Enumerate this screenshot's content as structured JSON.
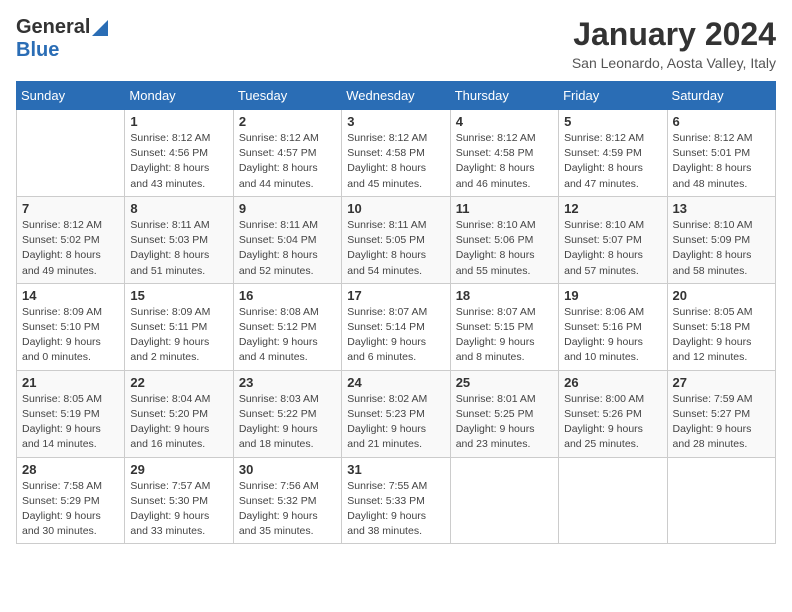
{
  "logo": {
    "general": "General",
    "blue": "Blue"
  },
  "title": "January 2024",
  "location": "San Leonardo, Aosta Valley, Italy",
  "weekdays": [
    "Sunday",
    "Monday",
    "Tuesday",
    "Wednesday",
    "Thursday",
    "Friday",
    "Saturday"
  ],
  "weeks": [
    [
      {
        "day": "",
        "sunrise": "",
        "sunset": "",
        "daylight": ""
      },
      {
        "day": "1",
        "sunrise": "Sunrise: 8:12 AM",
        "sunset": "Sunset: 4:56 PM",
        "daylight": "Daylight: 8 hours and 43 minutes."
      },
      {
        "day": "2",
        "sunrise": "Sunrise: 8:12 AM",
        "sunset": "Sunset: 4:57 PM",
        "daylight": "Daylight: 8 hours and 44 minutes."
      },
      {
        "day": "3",
        "sunrise": "Sunrise: 8:12 AM",
        "sunset": "Sunset: 4:58 PM",
        "daylight": "Daylight: 8 hours and 45 minutes."
      },
      {
        "day": "4",
        "sunrise": "Sunrise: 8:12 AM",
        "sunset": "Sunset: 4:58 PM",
        "daylight": "Daylight: 8 hours and 46 minutes."
      },
      {
        "day": "5",
        "sunrise": "Sunrise: 8:12 AM",
        "sunset": "Sunset: 4:59 PM",
        "daylight": "Daylight: 8 hours and 47 minutes."
      },
      {
        "day": "6",
        "sunrise": "Sunrise: 8:12 AM",
        "sunset": "Sunset: 5:01 PM",
        "daylight": "Daylight: 8 hours and 48 minutes."
      }
    ],
    [
      {
        "day": "7",
        "sunrise": "Sunrise: 8:12 AM",
        "sunset": "Sunset: 5:02 PM",
        "daylight": "Daylight: 8 hours and 49 minutes."
      },
      {
        "day": "8",
        "sunrise": "Sunrise: 8:11 AM",
        "sunset": "Sunset: 5:03 PM",
        "daylight": "Daylight: 8 hours and 51 minutes."
      },
      {
        "day": "9",
        "sunrise": "Sunrise: 8:11 AM",
        "sunset": "Sunset: 5:04 PM",
        "daylight": "Daylight: 8 hours and 52 minutes."
      },
      {
        "day": "10",
        "sunrise": "Sunrise: 8:11 AM",
        "sunset": "Sunset: 5:05 PM",
        "daylight": "Daylight: 8 hours and 54 minutes."
      },
      {
        "day": "11",
        "sunrise": "Sunrise: 8:10 AM",
        "sunset": "Sunset: 5:06 PM",
        "daylight": "Daylight: 8 hours and 55 minutes."
      },
      {
        "day": "12",
        "sunrise": "Sunrise: 8:10 AM",
        "sunset": "Sunset: 5:07 PM",
        "daylight": "Daylight: 8 hours and 57 minutes."
      },
      {
        "day": "13",
        "sunrise": "Sunrise: 8:10 AM",
        "sunset": "Sunset: 5:09 PM",
        "daylight": "Daylight: 8 hours and 58 minutes."
      }
    ],
    [
      {
        "day": "14",
        "sunrise": "Sunrise: 8:09 AM",
        "sunset": "Sunset: 5:10 PM",
        "daylight": "Daylight: 9 hours and 0 minutes."
      },
      {
        "day": "15",
        "sunrise": "Sunrise: 8:09 AM",
        "sunset": "Sunset: 5:11 PM",
        "daylight": "Daylight: 9 hours and 2 minutes."
      },
      {
        "day": "16",
        "sunrise": "Sunrise: 8:08 AM",
        "sunset": "Sunset: 5:12 PM",
        "daylight": "Daylight: 9 hours and 4 minutes."
      },
      {
        "day": "17",
        "sunrise": "Sunrise: 8:07 AM",
        "sunset": "Sunset: 5:14 PM",
        "daylight": "Daylight: 9 hours and 6 minutes."
      },
      {
        "day": "18",
        "sunrise": "Sunrise: 8:07 AM",
        "sunset": "Sunset: 5:15 PM",
        "daylight": "Daylight: 9 hours and 8 minutes."
      },
      {
        "day": "19",
        "sunrise": "Sunrise: 8:06 AM",
        "sunset": "Sunset: 5:16 PM",
        "daylight": "Daylight: 9 hours and 10 minutes."
      },
      {
        "day": "20",
        "sunrise": "Sunrise: 8:05 AM",
        "sunset": "Sunset: 5:18 PM",
        "daylight": "Daylight: 9 hours and 12 minutes."
      }
    ],
    [
      {
        "day": "21",
        "sunrise": "Sunrise: 8:05 AM",
        "sunset": "Sunset: 5:19 PM",
        "daylight": "Daylight: 9 hours and 14 minutes."
      },
      {
        "day": "22",
        "sunrise": "Sunrise: 8:04 AM",
        "sunset": "Sunset: 5:20 PM",
        "daylight": "Daylight: 9 hours and 16 minutes."
      },
      {
        "day": "23",
        "sunrise": "Sunrise: 8:03 AM",
        "sunset": "Sunset: 5:22 PM",
        "daylight": "Daylight: 9 hours and 18 minutes."
      },
      {
        "day": "24",
        "sunrise": "Sunrise: 8:02 AM",
        "sunset": "Sunset: 5:23 PM",
        "daylight": "Daylight: 9 hours and 21 minutes."
      },
      {
        "day": "25",
        "sunrise": "Sunrise: 8:01 AM",
        "sunset": "Sunset: 5:25 PM",
        "daylight": "Daylight: 9 hours and 23 minutes."
      },
      {
        "day": "26",
        "sunrise": "Sunrise: 8:00 AM",
        "sunset": "Sunset: 5:26 PM",
        "daylight": "Daylight: 9 hours and 25 minutes."
      },
      {
        "day": "27",
        "sunrise": "Sunrise: 7:59 AM",
        "sunset": "Sunset: 5:27 PM",
        "daylight": "Daylight: 9 hours and 28 minutes."
      }
    ],
    [
      {
        "day": "28",
        "sunrise": "Sunrise: 7:58 AM",
        "sunset": "Sunset: 5:29 PM",
        "daylight": "Daylight: 9 hours and 30 minutes."
      },
      {
        "day": "29",
        "sunrise": "Sunrise: 7:57 AM",
        "sunset": "Sunset: 5:30 PM",
        "daylight": "Daylight: 9 hours and 33 minutes."
      },
      {
        "day": "30",
        "sunrise": "Sunrise: 7:56 AM",
        "sunset": "Sunset: 5:32 PM",
        "daylight": "Daylight: 9 hours and 35 minutes."
      },
      {
        "day": "31",
        "sunrise": "Sunrise: 7:55 AM",
        "sunset": "Sunset: 5:33 PM",
        "daylight": "Daylight: 9 hours and 38 minutes."
      },
      {
        "day": "",
        "sunrise": "",
        "sunset": "",
        "daylight": ""
      },
      {
        "day": "",
        "sunrise": "",
        "sunset": "",
        "daylight": ""
      },
      {
        "day": "",
        "sunrise": "",
        "sunset": "",
        "daylight": ""
      }
    ]
  ]
}
